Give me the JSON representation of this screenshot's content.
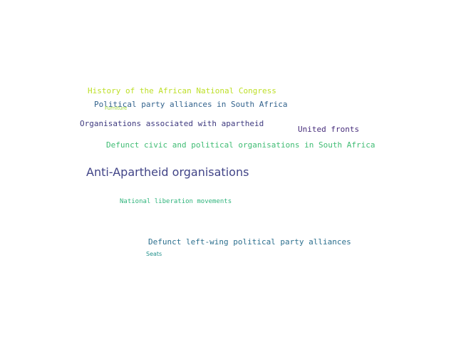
{
  "words": [
    {
      "text": "Anti-Apartheid organisations",
      "color": "#414487"
    },
    {
      "text": "Defunct civic and political organisations in South Africa",
      "color": "#3fbc73"
    },
    {
      "text": "Defunct left-wing political party alliances",
      "color": "#2c6f8e"
    },
    {
      "text": "History of the African National Congress",
      "color": "#bddf26"
    },
    {
      "text": "Organisations associated with apartheid",
      "color": "#3e3a7f"
    },
    {
      "text": "Political party alliances in South Africa",
      "color": "#33638d"
    },
    {
      "text": "United fronts",
      "color": "#472d7b"
    },
    {
      "text": "National liberation movements",
      "color": "#2fb47c"
    },
    {
      "text": "Furniture",
      "color": "#a0da39"
    },
    {
      "text": "Seats",
      "color": "#21918c"
    }
  ]
}
